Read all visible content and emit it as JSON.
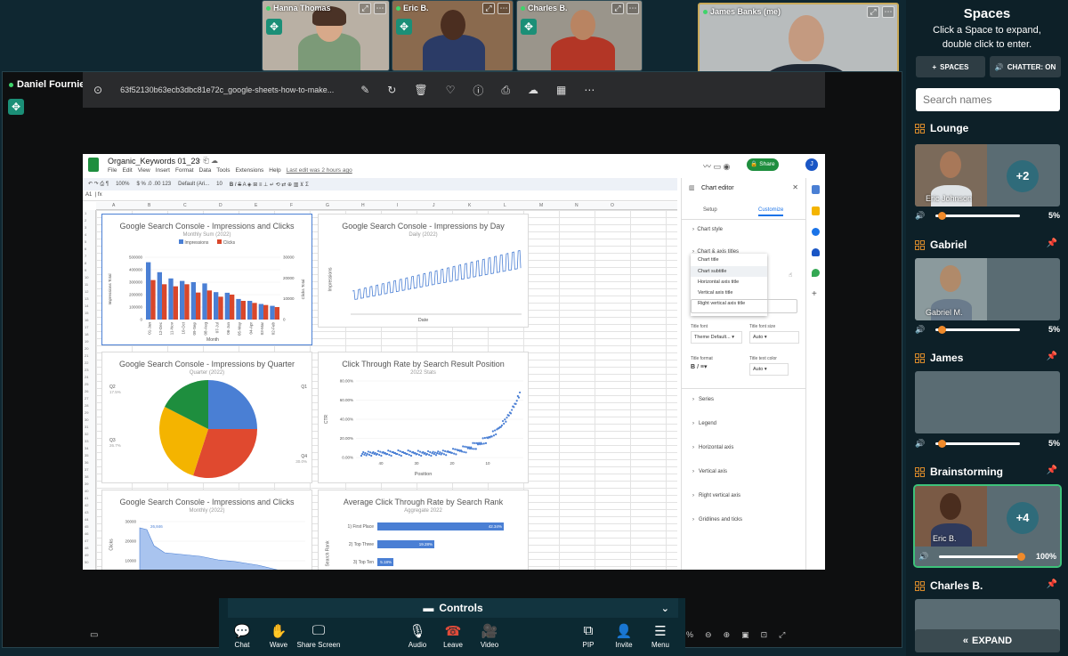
{
  "tiles": [
    {
      "name": "Hanna Thomas"
    },
    {
      "name": "Eric B."
    },
    {
      "name": "Charles B."
    },
    {
      "name": "James Banks (me)"
    }
  ],
  "presenter": {
    "name": "Daniel Fournier"
  },
  "share": {
    "filename": "63f52130b63ecb3dbc81e72c_google-sheets-how-to-make...",
    "zoom_label": "%"
  },
  "sheet": {
    "title": "Organic_Keywords 01_23",
    "menus": [
      "File",
      "Edit",
      "View",
      "Insert",
      "Format",
      "Data",
      "Tools",
      "Extensions",
      "Help"
    ],
    "last_edit": "Last edit was 2 hours ago",
    "share_label": "Share",
    "cell_ref": "A1",
    "zoom": "100%",
    "font": "Default (Ari...",
    "font_size": "10",
    "columns": [
      "A",
      "B",
      "C",
      "D",
      "E",
      "F",
      "G",
      "H",
      "I",
      "J",
      "K",
      "L",
      "M",
      "N",
      "O"
    ],
    "charts": [
      {
        "title": "Google Search Console - Impressions and Clicks",
        "subtitle": "Monthly Sum (2022)",
        "legend": [
          "Impressions",
          "Clicks"
        ],
        "xlabel": "Month",
        "ylabel": "Impressions Total",
        "y2label": "Clicks Total",
        "yticks": [
          "500000",
          "400000",
          "300000",
          "200000",
          "100000",
          "0"
        ],
        "y2ticks": [
          "30000",
          "20000",
          "10000",
          "0"
        ],
        "cats": [
          "01-Jan",
          "12-Dec",
          "11-Nov",
          "10-Oct",
          "09-Sep",
          "08-Aug",
          "07-Jul",
          "06-Jun",
          "05-May",
          "04-Apr",
          "03-Mar",
          "02-Feb"
        ]
      },
      {
        "title": "Google Search Console - Impressions by Day",
        "subtitle": "Daily (2022)",
        "xlabel": "Date",
        "ylabel": "Impressions"
      },
      {
        "title": "Google Search Console - Impressions by Quarter",
        "subtitle": "Quarter (2022)",
        "labels": [
          "Q1",
          "Q2",
          "Q3",
          "Q4"
        ],
        "pcts": [
          "",
          "17.5%",
          "26.7%",
          "30.0%"
        ]
      },
      {
        "title": "Click Through Rate by Search Result Position",
        "subtitle": "2022 Stats",
        "xlabel": "Position",
        "ylabel": "CTR",
        "yticks": [
          "80.00%",
          "60.00%",
          "40.00%",
          "20.00%",
          "0.00%"
        ],
        "xticks": [
          "40",
          "30",
          "20",
          "10"
        ]
      },
      {
        "title": "Google Search Console - Impressions and Clicks",
        "subtitle": "Monthly (2022)",
        "ylabel": "Clicks",
        "yticks": [
          "30000",
          "20000",
          "10000"
        ],
        "peak": "26,846"
      },
      {
        "title": "Average Click Through Rate by Search Rank",
        "subtitle": "Aggregate 2022",
        "ylabel": "Search Rank",
        "bars": [
          {
            "label": "1) First Place",
            "value": "42.34%"
          },
          {
            "label": "2) Top Three",
            "value": "19.28%"
          },
          {
            "label": "3) Top Ten",
            "value": "5.18%"
          }
        ]
      }
    ],
    "editor": {
      "title": "Chart editor",
      "tabs": [
        "Setup",
        "Customize"
      ],
      "sections": [
        "Chart style",
        "Chart & axis titles"
      ],
      "dropdown": [
        "Chart title",
        "Chart subtitle",
        "Horizontal axis title",
        "Vertical axis title",
        "Right vertical axis title"
      ],
      "title_font_label": "Title font",
      "title_font": "Theme Default...",
      "title_font_size_label": "Title font size",
      "title_font_size": "Auto",
      "title_format_label": "Title format",
      "title_text_color_label": "Title text color",
      "text_color": "Auto",
      "more_sections": [
        "Series",
        "Legend",
        "Horizontal axis",
        "Vertical axis",
        "Right vertical axis",
        "Gridlines and ticks"
      ]
    }
  },
  "controls": {
    "label": "Controls",
    "buttons": [
      {
        "label": "Chat",
        "icon": "chat-icon"
      },
      {
        "label": "Wave",
        "icon": "wave-icon"
      },
      {
        "label": "Share Screen",
        "icon": "screen-icon"
      },
      {
        "label": "Audio",
        "icon": "mic-icon"
      },
      {
        "label": "Leave",
        "icon": "phone-icon"
      },
      {
        "label": "Video",
        "icon": "camera-icon"
      },
      {
        "label": "PIP",
        "icon": "pip-icon"
      },
      {
        "label": "Invite",
        "icon": "invite-icon"
      },
      {
        "label": "Menu",
        "icon": "menu-icon"
      }
    ]
  },
  "panel": {
    "title": "Spaces",
    "subtitle1": "Click a Space to expand,",
    "subtitle2": "double click to enter.",
    "spaces_btn": "SPACES",
    "chatter_btn": "CHATTER: ON",
    "search_placeholder": "Search names",
    "rooms": [
      {
        "name": "Lounge",
        "person": "Eric Johnson",
        "extra": "+2",
        "volume": "5%",
        "level": 0.05
      },
      {
        "name": "Gabriel",
        "person": "Gabriel M.",
        "volume": "5%",
        "level": 0.05
      },
      {
        "name": "James",
        "volume": "5%",
        "level": 0.05
      },
      {
        "name": "Brainstorming",
        "person": "Eric B.",
        "extra": "+4",
        "volume": "100%",
        "level": 1.0
      },
      {
        "name": "Charles B."
      }
    ],
    "expand": "EXPAND"
  }
}
